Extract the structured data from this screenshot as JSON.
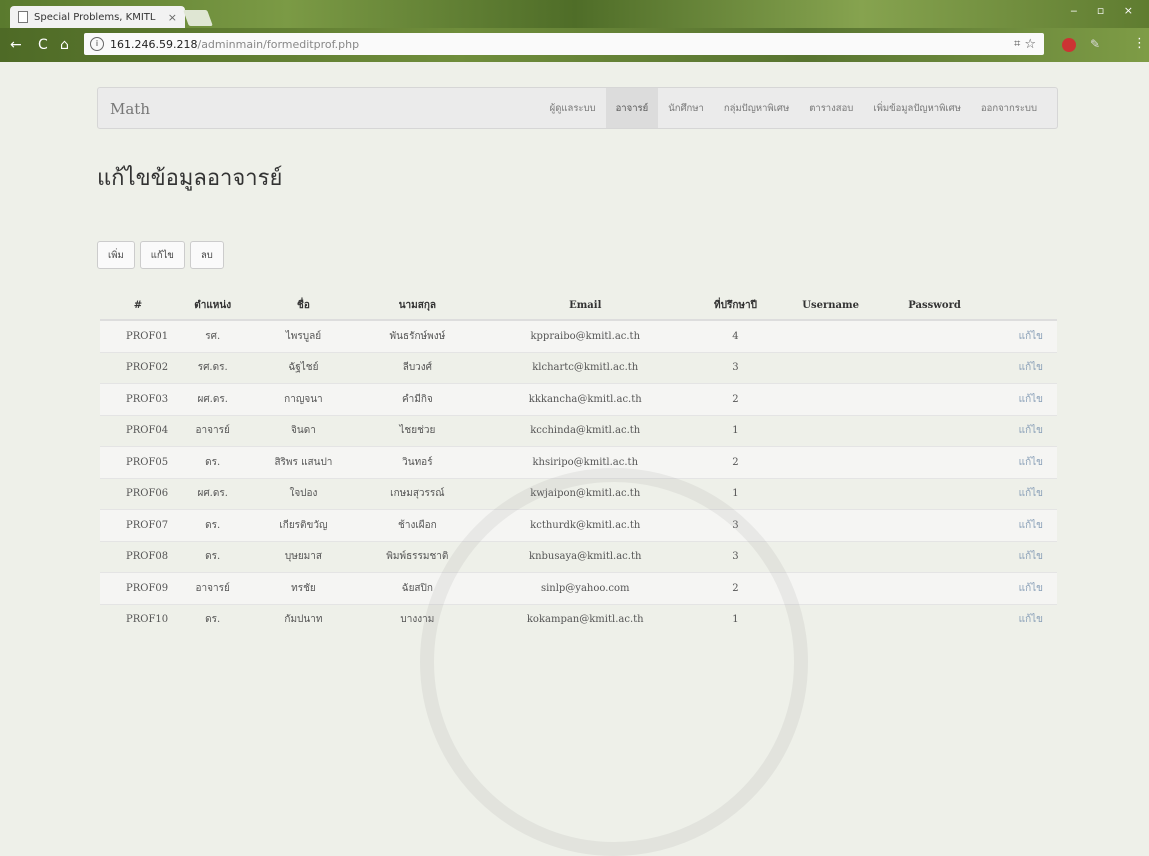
{
  "browser": {
    "tab_title": "Special Problems, KMITL",
    "tab_close": "×",
    "url_host": "161.246.59.218",
    "url_path": "/adminmain/formeditprof.php",
    "icons": [
      "back-icon",
      "reload-icon",
      "home-icon",
      "info-icon",
      "translate-icon",
      "star-icon",
      "abp-icon",
      "extension-icon",
      "menu-icon"
    ]
  },
  "navbar": {
    "brand": "Math",
    "items": [
      {
        "label": "ผู้ดูแลระบบ"
      },
      {
        "label": "อาจารย์",
        "active": true
      },
      {
        "label": "นักศึกษา"
      },
      {
        "label": "กลุ่มปัญหาพิเศษ"
      },
      {
        "label": "ตารางสอบ"
      },
      {
        "label": "เพิ่มข้อมูลปัญหาพิเศษ"
      },
      {
        "label": "ออกจากระบบ"
      }
    ]
  },
  "page": {
    "title": "แก้ไขข้อมูลอาจารย์",
    "buttons": {
      "add": "เพิ่ม",
      "edit": "แก้ไข",
      "delete": "ลบ"
    }
  },
  "table": {
    "headers": [
      "#",
      "ตำแหน่ง",
      "ชื่อ",
      "นามสกุล",
      "Email",
      "ที่ปรึกษาปี",
      "Username",
      "Password",
      ""
    ],
    "rows": [
      {
        "id": "PROF01",
        "position": "รศ.",
        "first": "ไพรบูลย์",
        "last": "พันธรักษ์พงษ์",
        "email": "kppraibo@kmitl.ac.th",
        "year": "4",
        "action": "แก้ไข"
      },
      {
        "id": "PROF02",
        "position": "รศ.ดร.",
        "first": "ฉัฐไชย์",
        "last": "ลีบวงศ์",
        "email": "klchartc@kmitl.ac.th",
        "year": "3",
        "action": "แก้ไข"
      },
      {
        "id": "PROF03",
        "position": "ผศ.ดร.",
        "first": "กาญจนา",
        "last": "คำมีกิจ",
        "email": "kkkancha@kmitl.ac.th",
        "year": "2",
        "action": "แก้ไข"
      },
      {
        "id": "PROF04",
        "position": "อาจารย์",
        "first": "จินดา",
        "last": "ไชยช่วย",
        "email": "kcchinda@kmitl.ac.th",
        "year": "1",
        "action": "แก้ไข"
      },
      {
        "id": "PROF05",
        "position": "ดร.",
        "first": "สิริพร แสนปา",
        "last": "วินทอร์",
        "email": "khsiripo@kmitl.ac.th",
        "year": "2",
        "action": "แก้ไข"
      },
      {
        "id": "PROF06",
        "position": "ผศ.ดร.",
        "first": "ใจปอง",
        "last": "เกษมสุวรรณ์",
        "email": "kwjaipon@kmitl.ac.th",
        "year": "1",
        "action": "แก้ไข"
      },
      {
        "id": "PROF07",
        "position": "ดร.",
        "first": "เกียรติขวัญ",
        "last": "ช้างเผือก",
        "email": "kcthurdk@kmitl.ac.th",
        "year": "3",
        "action": "แก้ไข"
      },
      {
        "id": "PROF08",
        "position": "ดร.",
        "first": "บุษยมาส",
        "last": "พิมพ์ธรรมชาติ",
        "email": "knbusaya@kmitl.ac.th",
        "year": "3",
        "action": "แก้ไข"
      },
      {
        "id": "PROF09",
        "position": "อาจารย์",
        "first": "ทรชัย",
        "last": "ฉัยสปิก",
        "email": "sinlp@yahoo.com",
        "year": "2",
        "action": "แก้ไข"
      },
      {
        "id": "PROF10",
        "position": "ดร.",
        "first": "กัมปนาท",
        "last": "บางงาม",
        "email": "kokampan@kmitl.ac.th",
        "year": "1",
        "action": "แก้ไข"
      }
    ]
  }
}
